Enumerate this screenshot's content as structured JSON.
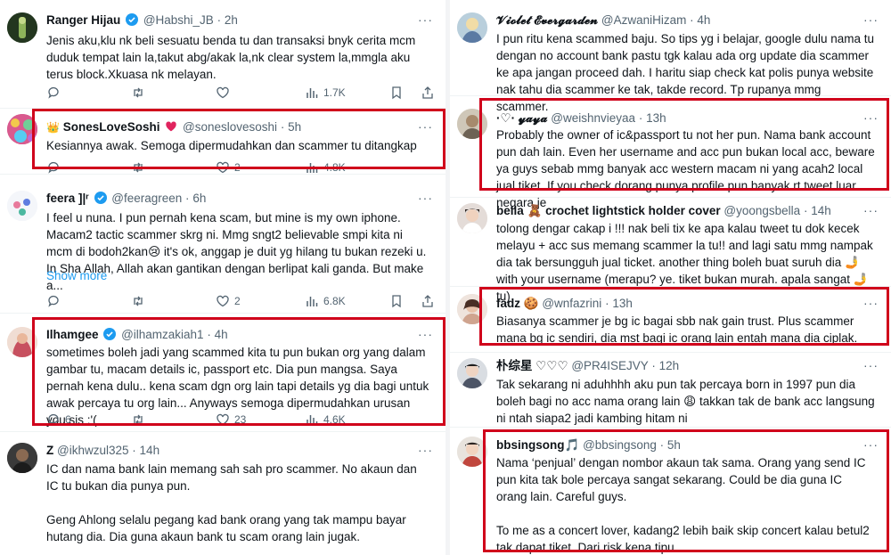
{
  "colors": {
    "highlight": "#d0021b",
    "verified": "#1d9bf0",
    "secondary": "#536471"
  },
  "left": [
    {
      "name": "Ranger Hijau",
      "handle": "@Habshi_JB",
      "time": "2h",
      "text": "Jenis aku,klu nk beli sesuatu benda tu dan transaksi bnyk cerita mcm duduk tempat lain la,takut abg/akak la,nk clear system la,mmgla aku terus block.Xkuasa nk melayan.",
      "views": "1.7K"
    },
    {
      "name": "SonesLoveSoshi",
      "name_emoji": "👑",
      "handle": "@soneslovesoshi",
      "time": "5h",
      "text": "Kesiannya awak. Semoga dipermudahkan dan scammer tu ditangkap",
      "likes": "2",
      "views": "4.8K"
    },
    {
      "name": "feera",
      "handle": "@feeragreen",
      "time": "6h",
      "text": "I feel u nuna. I pun pernah kena scam, but mine is my own iphone. Macam2 tactic scammer skrg ni. Mmg sngt2 believable smpi kita ni mcm di bodoh2kan😢 it's ok, anggap je duit yg hilang tu bukan rezeki u. In Sha Allah, Allah akan gantikan dengan berlipat kali ganda. But make a...",
      "show_more": "Show more",
      "likes": "2",
      "views": "6.8K"
    },
    {
      "name": "Ilhamgee",
      "handle": "@ilhamzakiah1",
      "time": "4h",
      "text": "sometimes boleh jadi yang scammed kita tu pun bukan org yang dalam gambar tu, macam details ic, passport etc. Dia pun mangsa. Saya pernah kena dulu.. kena scam dgn org lain tapi details yg dia bagi untuk awak percaya tu org lain... Anyways semoga dipermudahkan urusan you sis :'(",
      "replies": "6",
      "likes": "23",
      "views": "4.6K"
    },
    {
      "name": "Z",
      "handle": "@ikhwzul325",
      "time": "14h",
      "text": "IC dan nama bank lain memang sah sah pro scammer. No akaun dan IC tu bukan dia punya pun.\n\nGeng Ahlong selalu pegang kad bank orang yang tak mampu bayar hutang dia. Dia guna akaun bank tu scam orang lain jugak."
    }
  ],
  "right": [
    {
      "name": "𝓥𝓲𝓸𝓵𝓮𝓽 𝓔𝓿𝓮𝓻𝓰𝓪𝓻𝓭𝓮𝓷",
      "handle": "@AzwaniHizam",
      "time": "4h",
      "text": "I pun ritu kena scammed baju. So tips yg i belajar, google dulu nama tu dengan no account bank pastu tgk kalau ada org update dia scammer ke apa jangan proceed dah. I haritu siap check kat polis punya website nak tahu dia scammer ke tak, takde record. Tp rupanya mmg scammer."
    },
    {
      "name": "·♡· 𝔂𝓪𝔂𝓪",
      "handle": "@weishnvieyaa",
      "time": "13h",
      "text": "Probably the owner of ic&passport tu not her pun. Nama bank account pun dah lain. Even her username and acc pun bukan local acc, beware ya guys sebab mmg banyak acc western macam ni yang acah2 local jual tiket. If you check dorang punya profile pun banyak rt tweet luar negara je"
    },
    {
      "name": "bella 🧸 crochet lightstick holder cover",
      "handle": "@yoongsbella",
      "time": "14h",
      "text": "tolong dengar cakap i !!! nak beli tix ke apa kalau tweet tu dok kecek melayu + acc sus memang scammer la tu!! and lagi satu mmg nampak dia tak bersungguh jual ticket. another thing boleh buat suruh dia 🤳 with your username (merapu? ye. tiket bukan murah. apala sangat 🤳 tu)"
    },
    {
      "name": "fadz 🍪",
      "handle": "@wnfazrini",
      "time": "13h",
      "text": "Biasanya scammer je bg ic bagai sbb nak gain trust. Plus scammer mana bg ic sendiri, dia mst bagi ic orang lain entah mana dia ciplak."
    },
    {
      "name": "朴综星 ♡♡♡",
      "handle": "@PR4ISEJVY",
      "time": "12h",
      "text": "Tak sekarang ni aduhhhh aku pun tak percaya born in 1997 pun dia boleh bagi no acc nama orang lain 😩 takkan tak de bank acc langsung ni ntah siapa2 jadi kambing hitam ni"
    },
    {
      "name": "bbsingsong🎵",
      "handle": "@bbsingsong",
      "time": "5h",
      "text": "Nama ‘penjual’ dengan nombor akaun tak sama. Orang yang send IC pun kita tak bole percaya sangat sekarang. Could be dia guna IC orang lain. Careful guys.\n\nTo me as a concert lover, kadang2 lebih baik skip concert kalau betul2 tak dapat tiket. Dari risk kena tipu."
    }
  ]
}
